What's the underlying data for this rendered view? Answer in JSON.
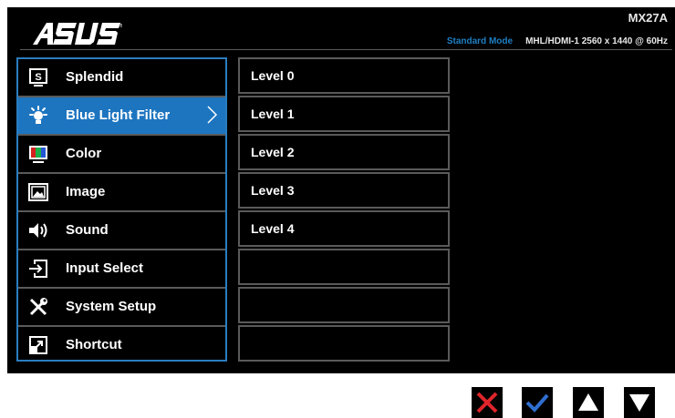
{
  "brand": "ASUS",
  "header": {
    "model": "MX27A",
    "mode": "Standard Mode",
    "signal": "MHL/HDMI-1  2560 x 1440 @ 60Hz"
  },
  "main_menu": [
    {
      "label": "Splendid",
      "icon": "splendid-icon",
      "selected": false
    },
    {
      "label": "Blue Light Filter",
      "icon": "bulb-icon",
      "selected": true
    },
    {
      "label": "Color",
      "icon": "color-icon",
      "selected": false
    },
    {
      "label": "Image",
      "icon": "image-icon",
      "selected": false
    },
    {
      "label": "Sound",
      "icon": "speaker-icon",
      "selected": false
    },
    {
      "label": "Input Select",
      "icon": "input-icon",
      "selected": false
    },
    {
      "label": "System Setup",
      "icon": "tools-icon",
      "selected": false
    },
    {
      "label": "Shortcut",
      "icon": "shortcut-icon",
      "selected": false
    }
  ],
  "sub_menu": [
    "Level 0",
    "Level 1",
    "Level 2",
    "Level 3",
    "Level 4",
    "",
    "",
    ""
  ],
  "buttons": [
    "close-icon",
    "confirm-icon",
    "up-arrow-icon",
    "down-arrow-icon"
  ],
  "colors": {
    "accent": "#1d75c0",
    "status_mode": "#1f7fc4",
    "close": "#e0252b",
    "confirm": "#2f6fd1",
    "button_bg": "#000000"
  }
}
